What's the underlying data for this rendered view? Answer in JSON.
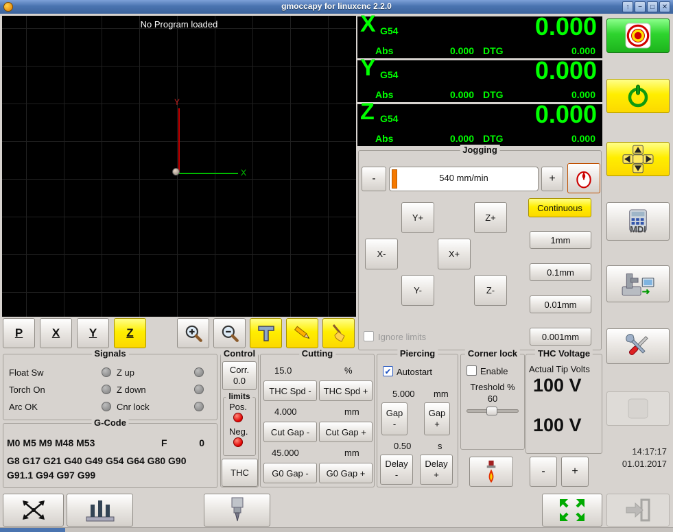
{
  "colors": {
    "titlebar_blue": "#4a74b0",
    "dro_green": "#00ff00",
    "dro_bg": "#000000",
    "active_yellow": "#ffee00",
    "estop_green": "#2ed42e",
    "led_off_gray": "#8e8e8e",
    "led_on_red": "#e00000",
    "axis_x_green": "#00bb00",
    "axis_y_red": "#cc0000",
    "slider_orange": "#f57900"
  },
  "titlebar": {
    "title": "gmoccapy for linuxcnc  2.2.0",
    "controls": {
      "rollup": "↑",
      "minimize": "−",
      "maximize": "□",
      "close": "✕"
    }
  },
  "preview": {
    "message": "No Program loaded",
    "x_axis_label": "X",
    "y_axis_label": "Y"
  },
  "preview_toolbar": {
    "p": "P",
    "x": "X",
    "y": "Y",
    "z": "Z"
  },
  "dro": {
    "axes": [
      {
        "letter": "X",
        "system": "G54",
        "value": "0.000",
        "abs_label": "Abs",
        "abs_value": "0.000",
        "dtg_label": "DTG",
        "dtg_value": "0.000"
      },
      {
        "letter": "Y",
        "system": "G54",
        "value": "0.000",
        "abs_label": "Abs",
        "abs_value": "0.000",
        "dtg_label": "DTG",
        "dtg_value": "0.000"
      },
      {
        "letter": "Z",
        "system": "G54",
        "value": "0.000",
        "abs_label": "Abs",
        "abs_value": "0.000",
        "dtg_label": "DTG",
        "dtg_value": "0.000"
      }
    ]
  },
  "jogging": {
    "title": "Jogging",
    "speed_minus": "-",
    "speed_value": "540 mm/min",
    "speed_plus": "+",
    "continuous": "Continuous",
    "jog": {
      "y_plus": "Y+",
      "z_plus": "Z+",
      "x_minus": "X-",
      "x_plus": "X+",
      "y_minus": "Y-",
      "z_minus": "Z-"
    },
    "increments": [
      "1mm",
      "0.1mm",
      "0.01mm",
      "0.001mm"
    ],
    "ignore_limits": "Ignore limits"
  },
  "signals": {
    "title": "Signals",
    "left": [
      {
        "label": "Float Sw"
      },
      {
        "label": "Torch On"
      },
      {
        "label": "Arc OK"
      }
    ],
    "right": [
      {
        "label": "Z up"
      },
      {
        "label": "Z down"
      },
      {
        "label": "Cnr lock"
      }
    ]
  },
  "gcode": {
    "title": "G-Code",
    "active_m": "M0 M5 M9 M48 M53",
    "f_label": "F",
    "f_value": "0",
    "active_g": "G8 G17 G21 G40 G49 G54 G64 G80 G90 G91.1 G94 G97 G99"
  },
  "control": {
    "title": "Control",
    "corr_label": "Corr.",
    "corr_value": "0.0",
    "limits_title": "limits",
    "pos_label": "Pos.",
    "neg_label": "Neg.",
    "thc_button": "THC"
  },
  "cutting": {
    "title": "Cutting",
    "speed_value": "15.0",
    "speed_unit": "%",
    "thc_spd_minus": "THC Spd -",
    "thc_spd_plus": "THC Spd +",
    "cut_gap_value": "4.000",
    "cut_gap_unit": "mm",
    "cut_gap_minus": "Cut Gap -",
    "cut_gap_plus": "Cut Gap +",
    "g0_gap_value": "45.000",
    "g0_gap_unit": "mm",
    "g0_gap_minus": "G0 Gap -",
    "g0_gap_plus": "G0 Gap +"
  },
  "piercing": {
    "title": "Piercing",
    "autostart": "Autostart",
    "autostart_check": "✔",
    "gap_value": "5.000",
    "gap_unit": "mm",
    "gap_minus": "Gap\n-",
    "gap_plus": "Gap\n+",
    "delay_value": "0.50",
    "delay_unit": "s",
    "delay_minus": "Delay\n-",
    "delay_plus": "Delay\n+"
  },
  "corner_lock": {
    "title": "Corner lock",
    "enable": "Enable",
    "threshold_label": "Treshold %",
    "threshold_value": "60"
  },
  "thc_voltage": {
    "title": "THC Voltage",
    "actual_label": "Actual Tip Volts",
    "actual_value": "100 V",
    "target_value": "100 V",
    "minus": "-",
    "plus": "+"
  },
  "clock": {
    "time": "14:17:17",
    "date": "01.01.2017"
  },
  "right_toolbar": {
    "mdi_label": "MDI"
  }
}
